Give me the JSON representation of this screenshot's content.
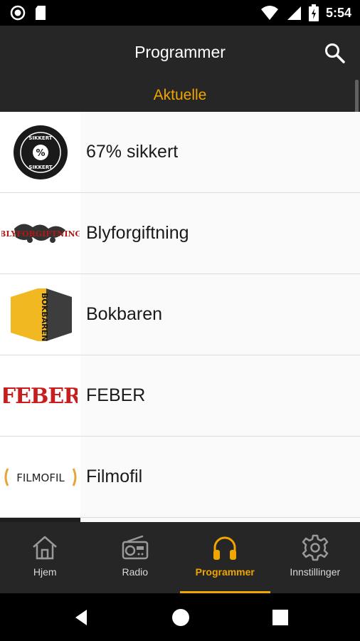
{
  "status_bar": {
    "time": "5:54"
  },
  "toolbar": {
    "title": "Programmer"
  },
  "tabs": [
    {
      "label": "Aktuelle"
    }
  ],
  "programs": [
    {
      "title": "67% sikkert",
      "logo_text": "SIKKERT",
      "logo_top": "SIKKERT"
    },
    {
      "title": "Blyforgiftning",
      "logo_text": "BLYFORGIFTNING"
    },
    {
      "title": "Bokbaren",
      "logo_text": "BOKBAREN"
    },
    {
      "title": "FEBER",
      "logo_text": "FEBER"
    },
    {
      "title": "Filmofil",
      "logo_text": "FILMOFIL"
    }
  ],
  "bottom_nav": [
    {
      "label": "Hjem",
      "icon": "home-icon"
    },
    {
      "label": "Radio",
      "icon": "radio-icon"
    },
    {
      "label": "Programmer",
      "icon": "headphones-icon",
      "active": true
    },
    {
      "label": "Innstillinger",
      "icon": "gear-icon"
    }
  ],
  "colors": {
    "accent": "#f0a500",
    "bar": "#262626",
    "list_bg": "#fafafa"
  }
}
